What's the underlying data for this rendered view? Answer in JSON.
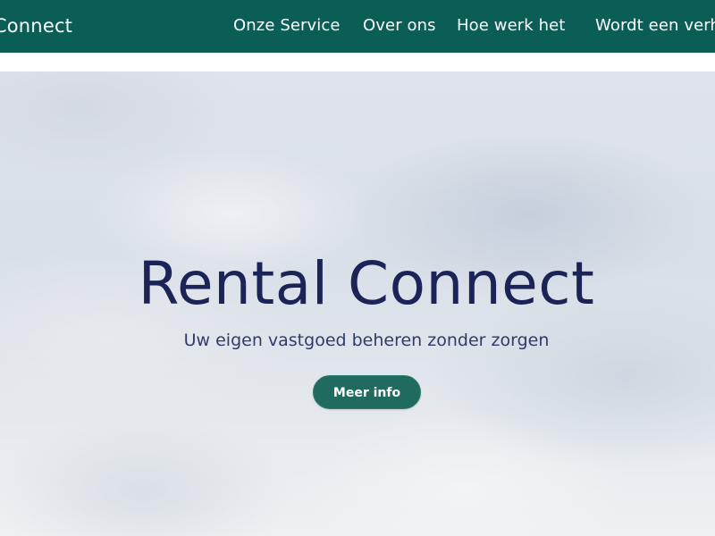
{
  "header": {
    "brand": "Rental Connect",
    "nav": [
      {
        "label": "Onze Service"
      },
      {
        "label": "Over ons"
      },
      {
        "label": "Hoe werk het"
      },
      {
        "label": "Wordt een verhuurder"
      }
    ]
  },
  "hero": {
    "title": "Rental Connect",
    "subtitle": "Uw eigen vastgoed beheren zonder zorgen",
    "cta_label": "Meer info"
  },
  "colors": {
    "header_bg": "#0b5e55",
    "title_text": "#1c2457",
    "button_bg": "#206a5f"
  }
}
